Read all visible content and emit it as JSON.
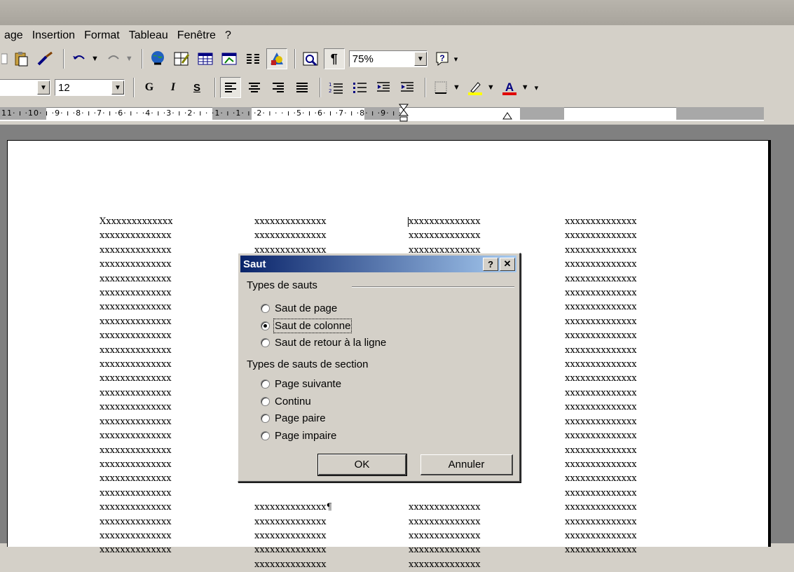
{
  "menu": [
    "age",
    "Insertion",
    "Format",
    "Tableau",
    "Fenêtre",
    "?"
  ],
  "toolbar": {
    "zoom": "75%",
    "font_size": "12",
    "bold": "G",
    "italic": "I",
    "underline": "S"
  },
  "ruler_text": "11· ı ·10· ı ·9· ı ·8· ı ·7· ı ·6· ı ·   ·4· ı ·3· ı ·2· ı ·   ·1· ı ·1· ı ·2· ı ·   · ı ·5· ı ·6· ı ·7· ı ·8· ı ·9· ı ·",
  "document": {
    "columns": [
      "Xxxxxxxxxxxxxx\nxxxxxxxxxxxxxx\nxxxxxxxxxxxxxx\nxxxxxxxxxxxxxx\nxxxxxxxxxxxxxx\nxxxxxxxxxxxxxx\nxxxxxxxxxxxxxx\nxxxxxxxxxxxxxx\nxxxxxxxxxxxxxx\nxxxxxxxxxxxxxx\nxxxxxxxxxxxxxx\nxxxxxxxxxxxxxx\nxxxxxxxxxxxxxx\nxxxxxxxxxxxxxx\nxxxxxxxxxxxxxx\nxxxxxxxxxxxxxx\nxxxxxxxxxxxxxx\nxxxxxxxxxxxxxx\nxxxxxxxxxxxxxx\nxxxxxxxxxxxxxx\nxxxxxxxxxxxxxx\nxxxxxxxxxxxxxx\nxxxxxxxxxxxxxx\nxxxxxxxxxxxxxx",
      "xxxxxxxxxxxxxx\nxxxxxxxxxxxxxx\nxxxxxxxxxxxxxx\n\n\n\n\n\n\n\n\n\n\n\n\n\n\n\n\n\nxxxxxxxxxxxxxx¶\nxxxxxxxxxxxxxx\nxxxxxxxxxxxxxx\nxxxxxxxxxxxxxx\nxxxxxxxxxxxxxx",
      "xxxxxxxxxxxxxx\nxxxxxxxxxxxxxx\nxxxxxxxxxxxxxx\n\n\n\n\n\n\n\n\n\n\n\n\n\n\n\n\n\nxxxxxxxxxxxxxx\nxxxxxxxxxxxxxx\nxxxxxxxxxxxxxx\nxxxxxxxxxxxxxx\nxxxxxxxxxxxxxx",
      "xxxxxxxxxxxxxx\nxxxxxxxxxxxxxx\nxxxxxxxxxxxxxx\nxxxxxxxxxxxxxx\nxxxxxxxxxxxxxx\nxxxxxxxxxxxxxx\nxxxxxxxxxxxxxx\nxxxxxxxxxxxxxx\nxxxxxxxxxxxxxx\nxxxxxxxxxxxxxx\nxxxxxxxxxxxxxx\nxxxxxxxxxxxxxx\nxxxxxxxxxxxxxx\nxxxxxxxxxxxxxx\nxxxxxxxxxxxxxx\nxxxxxxxxxxxxxx\nxxxxxxxxxxxxxx\nxxxxxxxxxxxxxx\nxxxxxxxxxxxxxx\nxxxxxxxxxxxxxx\nxxxxxxxxxxxxxx\nxxxxxxxxxxxxxx\nxxxxxxxxxxxxxx\nxxxxxxxxxxxxxx"
    ]
  },
  "dialog": {
    "title": "Saut",
    "help": "?",
    "close": "✕",
    "group1": "Types de sauts",
    "options1": [
      "Saut de page",
      "Saut de colonne",
      "Saut de retour à la ligne"
    ],
    "group2": "Types de sauts de section",
    "options2": [
      "Page suivante",
      "Continu",
      "Page paire",
      "Page impaire"
    ],
    "ok": "OK",
    "cancel": "Annuler",
    "selected": "Saut de colonne"
  }
}
